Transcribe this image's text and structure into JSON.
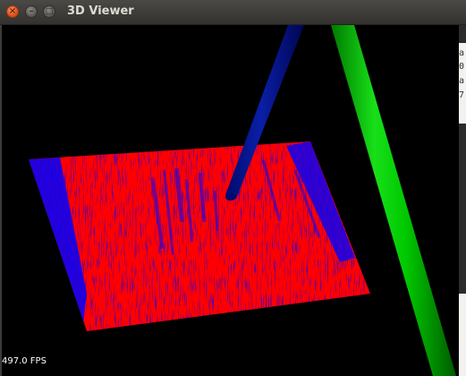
{
  "window": {
    "title": "3D Viewer",
    "controls": {
      "close_glyph": "×",
      "minimize_glyph": "–",
      "maximize_glyph": "□"
    }
  },
  "viewport": {
    "background": "#000000",
    "fps_label": "497.0 FPS",
    "objects": [
      {
        "name": "point-cloud-plane",
        "color": "#ff0000",
        "highlight_color": "#0000ff"
      },
      {
        "name": "blue-axis-rod",
        "color": "#000a8c"
      },
      {
        "name": "green-axis-rod",
        "color": "#00c400"
      }
    ]
  },
  "background_terminal": {
    "fragments": [
      "a",
      "0",
      "a",
      "7"
    ]
  }
}
